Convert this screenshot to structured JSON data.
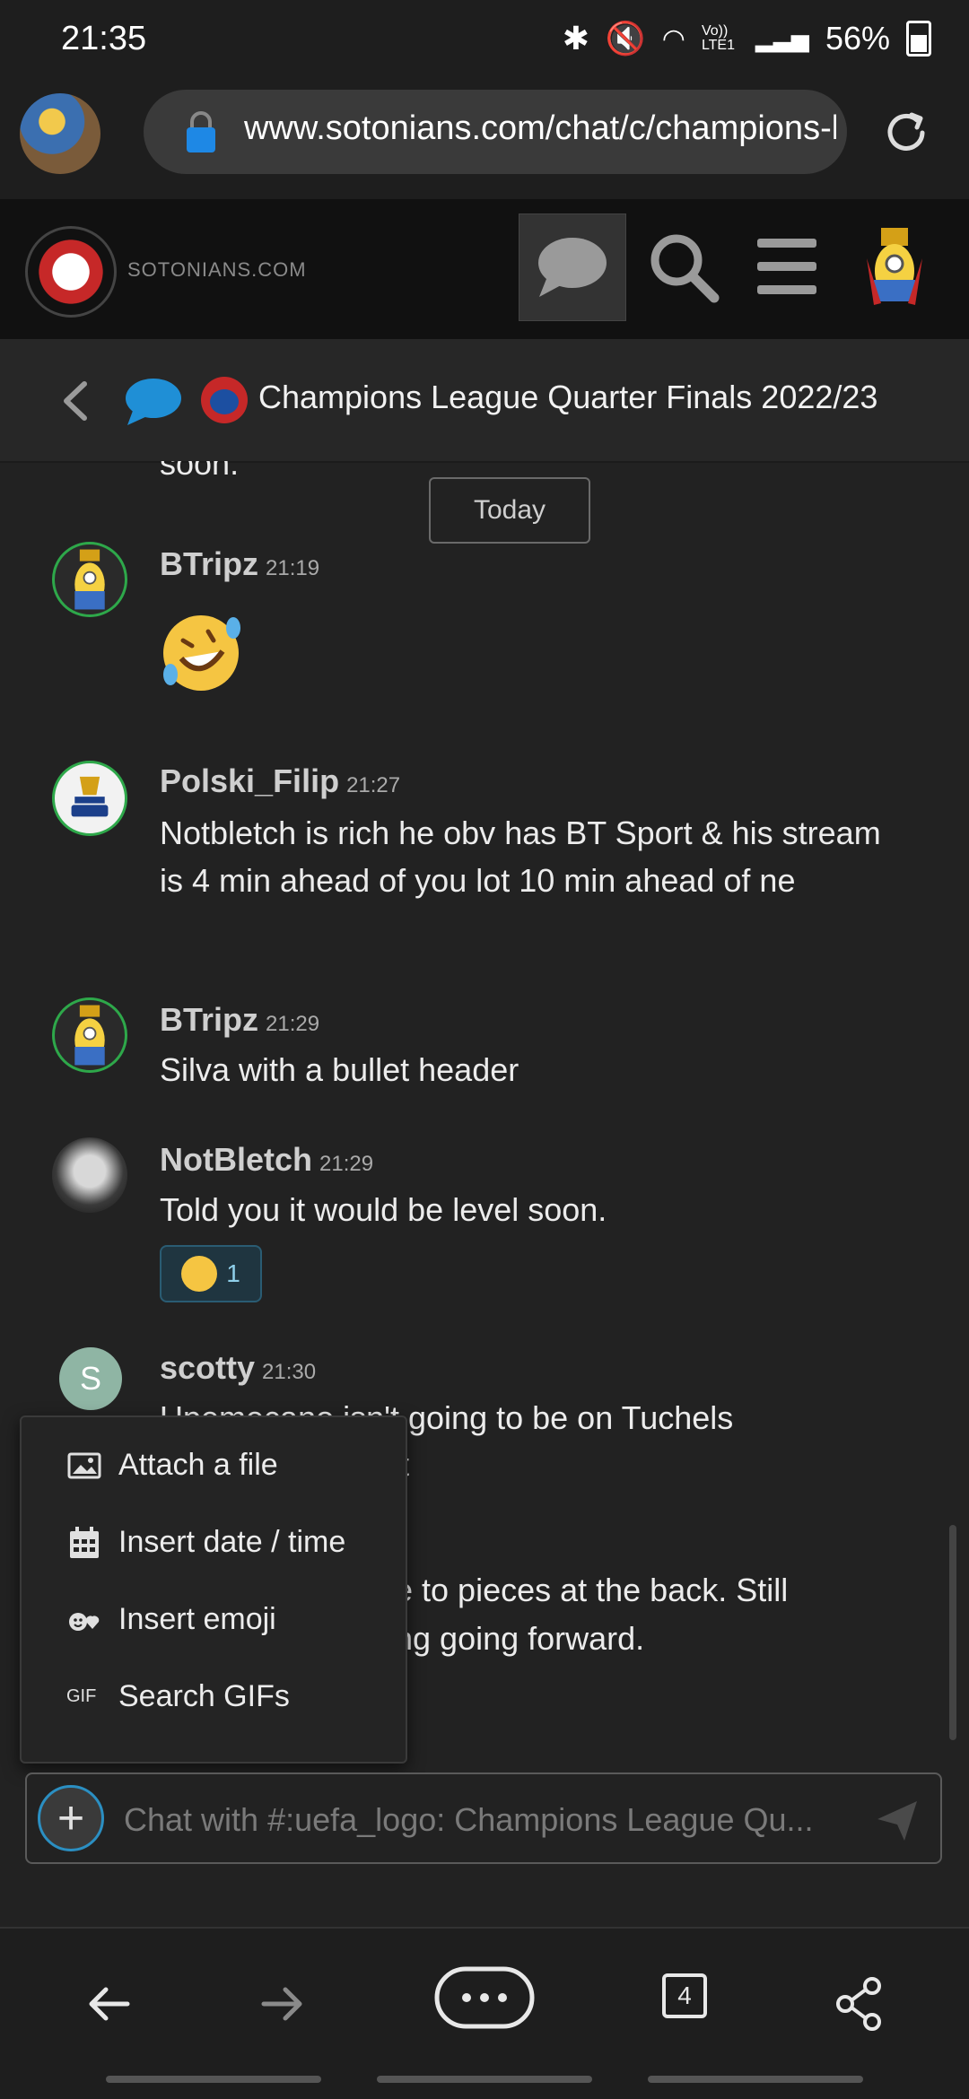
{
  "status_bar": {
    "time": "21:35",
    "battery": "56%",
    "network": "Vo)) LTE1"
  },
  "browser": {
    "url": "www.sotonians.com/chat/c/champions-lea",
    "tab_count": "4"
  },
  "site": {
    "name": "SOTONIANS.COM"
  },
  "channel": {
    "title": "Champions League Quarter Finals 2022/23"
  },
  "feed": {
    "cutoff_text": "soon.",
    "date_separator": "Today",
    "messages": [
      {
        "user": "BTripz",
        "time": "21:19",
        "text": ""
      },
      {
        "user": "Polski_Filip",
        "time": "21:27",
        "text": "Notbletch is rich he obv has BT Sport & his stream is 4 min ahead of you lot 10 min ahead of ne"
      },
      {
        "user": "BTripz",
        "time": "21:29",
        "text": "Silva with a bullet header"
      },
      {
        "user": "NotBletch",
        "time": "21:29",
        "text": "Told you it would be level soon.",
        "reaction_count": "1"
      },
      {
        "user": "scotty",
        "time": "21:30",
        "avatar_letter": "S",
        "text_line1": "Upemecano isn't going to be on Tuchels",
        "text_line2": "ist",
        "text_line3": "e to pieces at the back. Still",
        "text_line4": "ng going forward."
      }
    ]
  },
  "popup_menu": {
    "items": [
      {
        "label": "Attach a file",
        "icon": "image-icon"
      },
      {
        "label": "Insert date / time",
        "icon": "calendar-icon"
      },
      {
        "label": "Insert emoji",
        "icon": "emoji-icon"
      },
      {
        "label": "Search GIFs",
        "icon": "gif-icon",
        "icon_text": "GIF"
      }
    ]
  },
  "composer": {
    "placeholder": "Chat with #:uefa_logo: Champions League Qu..."
  },
  "colors": {
    "background": "#222222",
    "accent": "#2b8fc2",
    "avatar_ring": "#2ea84a"
  }
}
